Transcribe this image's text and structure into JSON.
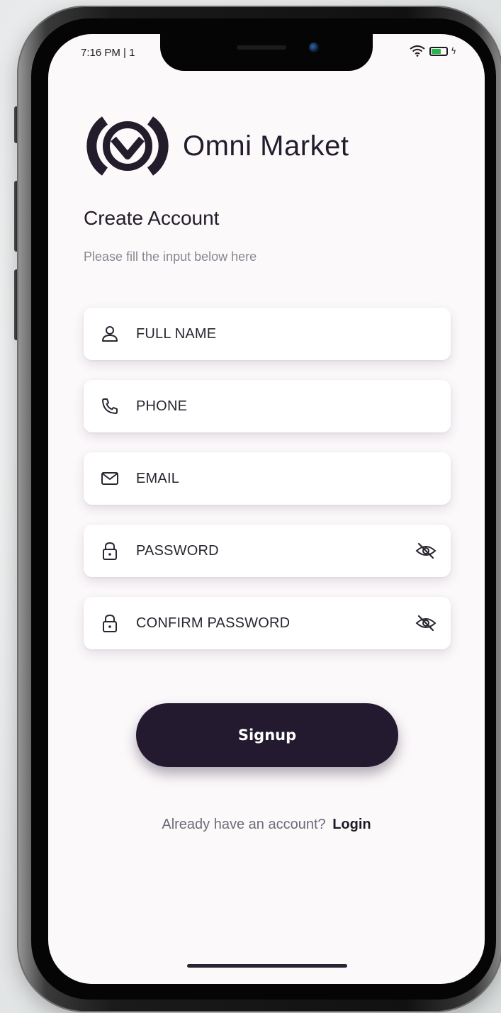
{
  "status_bar": {
    "time": "7:16 PM | 1"
  },
  "brand": {
    "name": "Omni Market",
    "logo_color": "#231c2b"
  },
  "header": {
    "title": "Create Account",
    "subtitle": "Please fill the input below here"
  },
  "form": {
    "fields": [
      {
        "placeholder": "FULL NAME",
        "icon": "user-icon"
      },
      {
        "placeholder": "PHONE",
        "icon": "phone-icon"
      },
      {
        "placeholder": "EMAIL",
        "icon": "mail-icon"
      },
      {
        "placeholder": "PASSWORD",
        "icon": "lock-icon",
        "trailing_icon": "eye-off-icon"
      },
      {
        "placeholder": "CONFIRM PASSWORD",
        "icon": "lock-icon",
        "trailing_icon": "eye-off-icon"
      }
    ],
    "submit_label": "Signup"
  },
  "footer": {
    "prompt": "Already have an account?",
    "link_label": "Login"
  },
  "colors": {
    "primary": "#231a2f",
    "screen_bg": "#fcf9fb",
    "battery": "#27b44a"
  }
}
